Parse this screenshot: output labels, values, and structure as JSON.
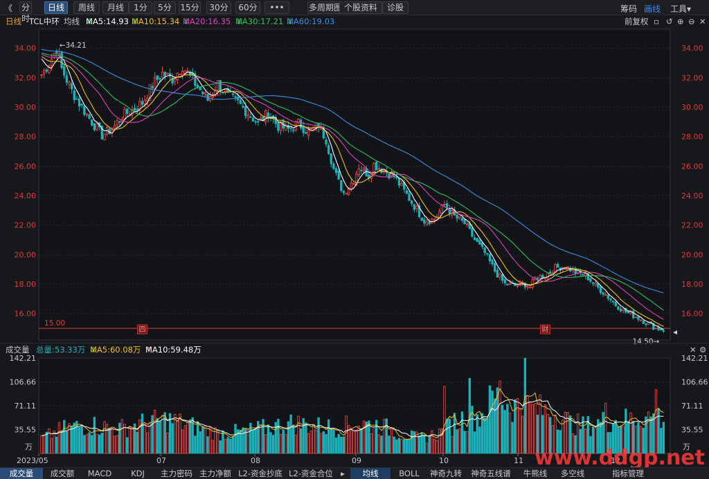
{
  "toolbar": {
    "back": "《",
    "buttons": [
      "分时",
      "日线",
      "周线",
      "月线",
      "1分",
      "5分",
      "15分",
      "30分",
      "60分",
      "•••",
      "多周期图",
      "个股资料",
      "诊股"
    ],
    "active_index": 1,
    "multi_period_arrow": "▾",
    "right": [
      "筹码",
      "画线",
      "工具"
    ],
    "right_active_index": 1,
    "tools_arrow": "▾"
  },
  "info": {
    "period": "日线",
    "stock": "TCL中环",
    "avg_label": "均线",
    "ma5": "MA5:14.93",
    "ma10": "MA10:15.34",
    "ma20": "MA20:16.35",
    "ma30": "MA30:17.21",
    "ma60": "MA60:19.03",
    "down_arrow": "↓",
    "up_arrow": "↑",
    "adjust": "前复权",
    "icons": [
      "▫",
      "↺",
      "⊕",
      "⊖",
      "✕"
    ]
  },
  "colors": {
    "ma5": "#ffffff",
    "ma10": "#f0c020",
    "ma20": "#e040c0",
    "ma30": "#30c060",
    "ma60": "#3a8ee8",
    "up": "#ff4a4a",
    "down": "#1fb0b8",
    "axis_text": "#e03a3a",
    "ref_line": "#d83c3c"
  },
  "price_axis": {
    "min": 14.2,
    "max": 35.3,
    "ticks": [
      "34.00",
      "32.00",
      "30.00",
      "28.00",
      "26.00",
      "24.00",
      "22.00",
      "20.00",
      "18.00",
      "16.00"
    ]
  },
  "annotations": {
    "high": "←34.21",
    "low": "14.50→",
    "ref": "15.00",
    "mark_si": "四",
    "mark_cai": "财"
  },
  "volume": {
    "title": "成交量",
    "total": "总量:53.33万",
    "ma5": "MA5:60.08万",
    "ma10": "MA10:59.48万",
    "ticks": [
      "142.21",
      "106.66",
      "71.11",
      "35.55"
    ],
    "unit": "万",
    "max": 142.21,
    "close_icon": "✕",
    "gear_icon": "⚙"
  },
  "dates": [
    "2023/05",
    "07",
    "08",
    "09",
    "10",
    "11",
    "12"
  ],
  "bottom_tabs": [
    "成交量",
    "成交额",
    "MACD",
    "KDJ",
    "主力密码",
    "主力净额",
    "L2-资金抄底",
    "L2-资金合位",
    "▸",
    "均线",
    "BOLL",
    "神奇九转",
    "神奇五线谱",
    "牛熊线",
    "多空线",
    "指标管理"
  ],
  "watermark": "www.ddgp.net",
  "chart_data": {
    "type": "candlestick",
    "title": "TCL中环 日线",
    "ylim": [
      14.2,
      35.3
    ],
    "x_labels": [
      "2023/05",
      "07",
      "08",
      "09",
      "10",
      "11",
      "12"
    ],
    "anchors": [
      [
        0,
        32.2
      ],
      [
        4,
        33.3
      ],
      [
        6,
        34.0
      ],
      [
        8,
        32.6
      ],
      [
        12,
        31.1
      ],
      [
        16,
        30.0
      ],
      [
        20,
        29.0
      ],
      [
        24,
        28.1
      ],
      [
        28,
        28.5
      ],
      [
        32,
        29.4
      ],
      [
        36,
        29.8
      ],
      [
        40,
        30.3
      ],
      [
        44,
        31.5
      ],
      [
        48,
        32.3
      ],
      [
        52,
        31.9
      ],
      [
        56,
        32.8
      ],
      [
        60,
        31.8
      ],
      [
        62,
        31.4
      ],
      [
        66,
        30.5
      ],
      [
        70,
        31.6
      ],
      [
        74,
        30.8
      ],
      [
        78,
        30.3
      ],
      [
        82,
        29.6
      ],
      [
        86,
        28.9
      ],
      [
        90,
        29.6
      ],
      [
        94,
        28.7
      ],
      [
        98,
        28.5
      ],
      [
        102,
        28.9
      ],
      [
        106,
        28.3
      ],
      [
        110,
        28.8
      ],
      [
        113,
        27.8
      ],
      [
        116,
        25.8
      ],
      [
        118,
        24.9
      ],
      [
        120,
        24.2
      ],
      [
        124,
        25.1
      ],
      [
        126,
        26.0
      ],
      [
        130,
        25.4
      ],
      [
        132,
        26.1
      ],
      [
        136,
        25.7
      ],
      [
        140,
        25.3
      ],
      [
        144,
        24.3
      ],
      [
        148,
        23.3
      ],
      [
        152,
        22.3
      ],
      [
        156,
        22.4
      ],
      [
        160,
        23.4
      ],
      [
        164,
        22.6
      ],
      [
        168,
        22.1
      ],
      [
        172,
        21.0
      ],
      [
        176,
        20.1
      ],
      [
        180,
        18.9
      ],
      [
        184,
        18.0
      ],
      [
        188,
        17.9
      ],
      [
        192,
        18.0
      ],
      [
        194,
        17.8
      ],
      [
        196,
        18.4
      ],
      [
        200,
        18.6
      ],
      [
        204,
        19.1
      ],
      [
        208,
        19.2
      ],
      [
        212,
        18.8
      ],
      [
        216,
        18.6
      ],
      [
        220,
        17.9
      ],
      [
        224,
        17.3
      ],
      [
        228,
        16.6
      ],
      [
        232,
        16.1
      ],
      [
        236,
        15.8
      ],
      [
        240,
        15.4
      ],
      [
        244,
        15.0
      ],
      [
        247,
        14.9
      ]
    ],
    "volume_anchors": [
      [
        0,
        22
      ],
      [
        10,
        38
      ],
      [
        20,
        42
      ],
      [
        30,
        36
      ],
      [
        40,
        44
      ],
      [
        50,
        50
      ],
      [
        60,
        40
      ],
      [
        70,
        30
      ],
      [
        80,
        32
      ],
      [
        90,
        38
      ],
      [
        100,
        45
      ],
      [
        110,
        40
      ],
      [
        118,
        38
      ],
      [
        126,
        44
      ],
      [
        134,
        42
      ],
      [
        142,
        30
      ],
      [
        150,
        22
      ],
      [
        158,
        30
      ],
      [
        166,
        50
      ],
      [
        174,
        55
      ],
      [
        180,
        85
      ],
      [
        186,
        72
      ],
      [
        192,
        68
      ],
      [
        198,
        64
      ],
      [
        204,
        60
      ],
      [
        210,
        45
      ],
      [
        216,
        40
      ],
      [
        224,
        48
      ],
      [
        232,
        50
      ],
      [
        240,
        55
      ],
      [
        247,
        53
      ]
    ],
    "volume_spikes": [
      [
        160,
        100
      ],
      [
        164,
        60
      ],
      [
        170,
        112
      ],
      [
        182,
        108
      ],
      [
        183,
        72
      ],
      [
        192,
        142
      ],
      [
        224,
        75
      ],
      [
        244,
        95
      ]
    ],
    "markers": {
      "high": {
        "i": 6,
        "price": 34.21
      },
      "low": {
        "i": 247,
        "price": 14.5
      },
      "ref_price": 15.0
    }
  }
}
